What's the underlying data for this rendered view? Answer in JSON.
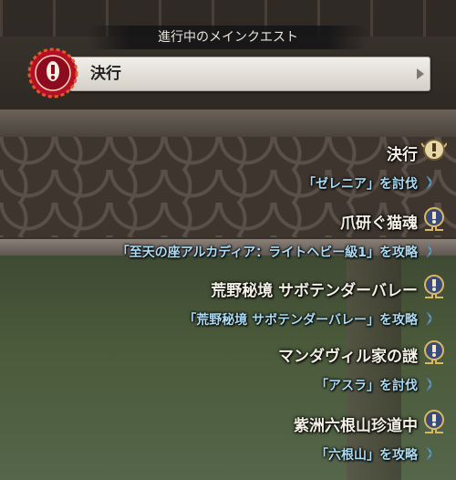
{
  "header": {
    "title": "進行中のメインクエスト"
  },
  "main_quest": {
    "label": "決行"
  },
  "quests": [
    {
      "title": "決行",
      "objective": "「ゼレニア」を討伐",
      "icon": "main-quest-icon"
    },
    {
      "title": "爪研ぐ猫魂",
      "objective": "「至天の座アルカディア：ライトヘビー級1」を攻略",
      "icon": "quest-marker-icon"
    },
    {
      "title": "荒野秘境 サボテンダーバレー",
      "objective": "「荒野秘境 サボテンダーバレー」を攻略",
      "icon": "quest-marker-icon"
    },
    {
      "title": "マンダヴィル家の謎",
      "objective": "「アスラ」を討伐",
      "icon": "quest-marker-icon"
    },
    {
      "title": "紫洲六根山珍道中",
      "objective": "「六根山」を攻略",
      "icon": "quest-marker-icon"
    }
  ],
  "colors": {
    "title_text": "#f4f0e6",
    "objective_text": "#a9dcf5",
    "badge_red": "#c8102e",
    "marker_gold": "#d8b860"
  }
}
